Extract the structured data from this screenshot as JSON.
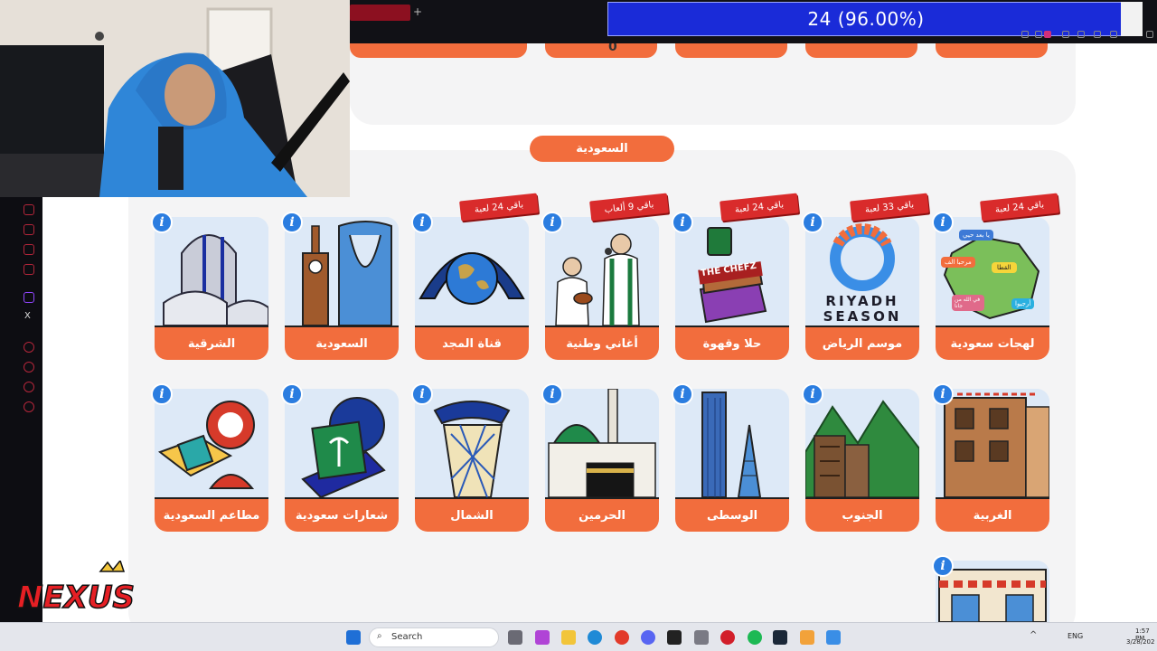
{
  "browser": {
    "score_text": "24  (96.00%)"
  },
  "section": {
    "title": "السعودية"
  },
  "cards_row1": [
    {
      "label": "الشرقية",
      "ribbon": "",
      "icon": "buildings-icon"
    },
    {
      "label": "السعودية",
      "ribbon": "",
      "icon": "kingdom-tower-icon"
    },
    {
      "label": "قناة المجد",
      "ribbon": "باقي 24 لعبة",
      "icon": "globe-icon"
    },
    {
      "label": "أغاني وطنية",
      "ribbon": "باقي 9 ألعاب",
      "icon": "musicians-icon"
    },
    {
      "label": "حلا وقهوة",
      "ribbon": "باقي 24 لعبة",
      "icon": "coffee-box-icon"
    },
    {
      "label": "موسم الرياض",
      "ribbon": "باقي 33 لعبة",
      "icon": "riyadh-season-icon"
    },
    {
      "label": "لهجات سعودية",
      "ribbon": "باقي 24 لعبة",
      "icon": "map-icon"
    }
  ],
  "cards_row2": [
    {
      "label": "مطاعم السعودية",
      "icon": "food-icon"
    },
    {
      "label": "شعارات سعودية",
      "icon": "emblem-icon"
    },
    {
      "label": "الشمال",
      "icon": "tower-icon"
    },
    {
      "label": "الحرمين",
      "icon": "mosque-icon"
    },
    {
      "label": "الوسطى",
      "icon": "skyline-icon"
    },
    {
      "label": "الجنوب",
      "icon": "mountains-icon"
    },
    {
      "label": "الغربية",
      "icon": "old-buildings-icon"
    }
  ],
  "riyadh_season_art": {
    "line1": "RIYADH",
    "line2": "SEASON"
  },
  "coffee_art": {
    "text": "THE CHEFZ"
  },
  "map_bubbles": [
    "يا بعد حيي",
    "مرحبا الف",
    "القطا",
    "في الله من جانا",
    "أرجيوا"
  ],
  "prev_row": {
    "zero": "0"
  },
  "taskbar": {
    "search_label": "Search",
    "lang": "ENG",
    "time": "1:57 PM",
    "date": "3/28/202"
  },
  "overlay": {
    "nexus": "NEXUS"
  },
  "sidebar_icons": [
    "X"
  ],
  "colors": {
    "accent": "#f26d3d",
    "info": "#2b7de0",
    "ribbon": "#d92b2b",
    "score_bar": "#1a2bd8"
  }
}
